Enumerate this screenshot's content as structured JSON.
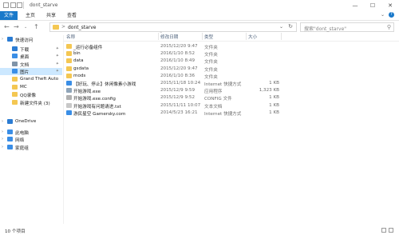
{
  "window": {
    "title": "dont_starve",
    "controls": {
      "minimize": "—",
      "maximize": "☐",
      "close": "✕"
    }
  },
  "ribbon": {
    "tabs": [
      {
        "label": "文件"
      },
      {
        "label": "主页"
      },
      {
        "label": "共享"
      },
      {
        "label": "查看"
      }
    ],
    "accent_color": "#1979ca"
  },
  "address_bar": {
    "separator": ">",
    "path": "dont_starve",
    "search_placeholder": "搜索\"dont_starve\""
  },
  "sidebar": {
    "items": [
      {
        "label": "快速访问",
        "icon": "star-icon",
        "color": "#2b7cd3",
        "pinned": false,
        "selected": false,
        "expander": true
      },
      {
        "label": "下载",
        "icon": "download-icon",
        "color": "#2b7cd3",
        "pinned": true,
        "selected": false,
        "expander": false
      },
      {
        "label": "桌面",
        "icon": "desktop-icon",
        "color": "#3a8ee6",
        "pinned": true,
        "selected": false,
        "expander": false
      },
      {
        "label": "文档",
        "icon": "document-icon",
        "color": "#7f93a8",
        "pinned": true,
        "selected": false,
        "expander": false
      },
      {
        "label": "图片",
        "icon": "picture-icon",
        "color": "#3a8ee6",
        "pinned": true,
        "selected": true,
        "expander": false
      },
      {
        "label": "Grand Theft Auto",
        "icon": "folder-icon",
        "color": "#f4c752",
        "pinned": false,
        "selected": false,
        "expander": false
      },
      {
        "label": "MC",
        "icon": "folder-icon",
        "color": "#f4c752",
        "pinned": false,
        "selected": false,
        "expander": false
      },
      {
        "label": "QQ录像",
        "icon": "folder-icon",
        "color": "#f4c752",
        "pinned": false,
        "selected": false,
        "expander": false
      },
      {
        "label": "新建文件夹 (3)",
        "icon": "folder-icon",
        "color": "#f4c752",
        "pinned": false,
        "selected": false,
        "expander": false
      },
      {
        "label": "OneDrive",
        "icon": "cloud-icon",
        "color": "#2b7cd3",
        "pinned": false,
        "selected": false,
        "expander": true
      },
      {
        "label": "此电脑",
        "icon": "computer-icon",
        "color": "#3a8ee6",
        "pinned": false,
        "selected": false,
        "expander": true
      },
      {
        "label": "网络",
        "icon": "network-icon",
        "color": "#3a8ee6",
        "pinned": false,
        "selected": false,
        "expander": true
      },
      {
        "label": "家庭组",
        "icon": "homegroup-icon",
        "color": "#3a8ee6",
        "pinned": false,
        "selected": false,
        "expander": true
      }
    ]
  },
  "file_list": {
    "columns": {
      "name": "名称",
      "date": "修改日期",
      "type": "类型",
      "size": "大小"
    },
    "rows": [
      {
        "name": "_运行必备组件",
        "date": "2015/12/20 9:47",
        "type": "文件夹",
        "size": "",
        "icon": "folder-icon",
        "color": "#f4c752"
      },
      {
        "name": "bin",
        "date": "2016/1/10 8:52",
        "type": "文件夹",
        "size": "",
        "icon": "folder-icon",
        "color": "#f4c752"
      },
      {
        "name": "data",
        "date": "2016/1/10 8:49",
        "type": "文件夹",
        "size": "",
        "icon": "folder-icon",
        "color": "#f4c752"
      },
      {
        "name": "gsdata",
        "date": "2015/12/20 9:47",
        "type": "文件夹",
        "size": "",
        "icon": "folder-icon",
        "color": "#f4c752"
      },
      {
        "name": "mods",
        "date": "2016/1/10 8:36",
        "type": "文件夹",
        "size": "",
        "icon": "folder-icon",
        "color": "#f4c752"
      },
      {
        "name": "【好玩、停止】休闲像素小游戏",
        "date": "2015/11/18 10:24",
        "type": "Internet 快捷方式",
        "size": "1 KB",
        "icon": "internet-shortcut-icon",
        "color": "#3a8ee6"
      },
      {
        "name": "开始游戏.exe",
        "date": "2015/12/9 9:59",
        "type": "应用程序",
        "size": "1,323 KB",
        "icon": "application-icon",
        "color": "#8fa4b8"
      },
      {
        "name": "开始游戏.exe.config",
        "date": "2015/12/9 9:52",
        "type": "CONFIG 文件",
        "size": "1 KB",
        "icon": "config-file-icon",
        "color": "#b0b0b0"
      },
      {
        "name": "开始游戏有问题请进.txt",
        "date": "2015/11/11 10:07",
        "type": "文本文档",
        "size": "1 KB",
        "icon": "text-file-icon",
        "color": "#c8c8c8"
      },
      {
        "name": "游民星空 Gamersky.com",
        "date": "2014/5/23 16:21",
        "type": "Internet 快捷方式",
        "size": "1 KB",
        "icon": "internet-shortcut-icon",
        "color": "#3a8ee6"
      }
    ]
  },
  "status_bar": {
    "item_count": "10 个项目"
  }
}
